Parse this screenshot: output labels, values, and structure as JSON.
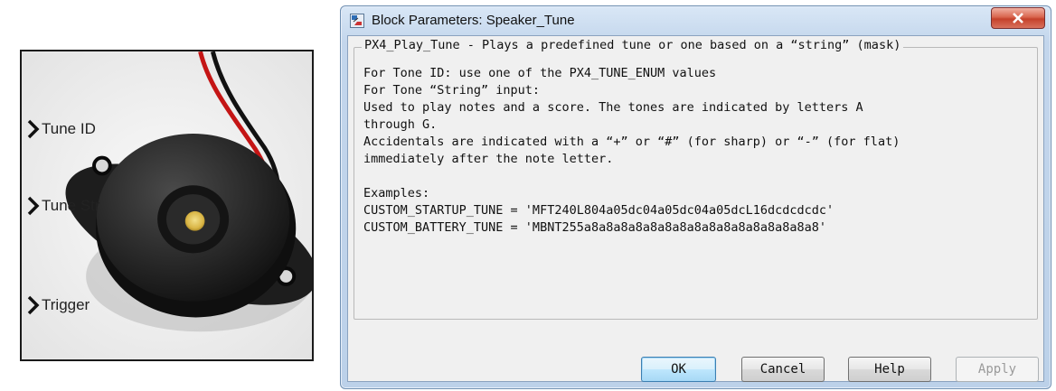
{
  "block": {
    "ports": [
      {
        "label": "Tune ID"
      },
      {
        "label": "Tune Str"
      },
      {
        "label": "Trigger"
      }
    ],
    "image": "piezo-buzzer"
  },
  "dialog": {
    "title": "Block Parameters: Speaker_Tune",
    "group_title": "PX4_Play_Tune - Plays a predefined tune or one based on a “string” (mask)",
    "description": [
      "For Tone ID: use one of the PX4_TUNE_ENUM values",
      "For Tone “String” input:",
      "Used to play notes and a score. The tones are indicated by letters A",
      "through G.",
      "Accidentals are indicated with a “+” or “#” (for sharp) or “-” (for flat)",
      "immediately after the note letter.",
      "",
      "Examples:",
      "CUSTOM_STARTUP_TUNE = 'MFT240L804a05dc04a05dc04a05dcL16dcdcdcdc'",
      "CUSTOM_BATTERY_TUNE = 'MBNT255a8a8a8a8a8a8a8a8a8a8a8a8a8a8a8a8'"
    ],
    "buttons": {
      "ok": "OK",
      "cancel": "Cancel",
      "help": "Help",
      "apply": "Apply"
    }
  },
  "colors": {
    "titlebar": "#c3d6ec",
    "close_button": "#c5412b",
    "ok_border": "#3c7fb1"
  }
}
